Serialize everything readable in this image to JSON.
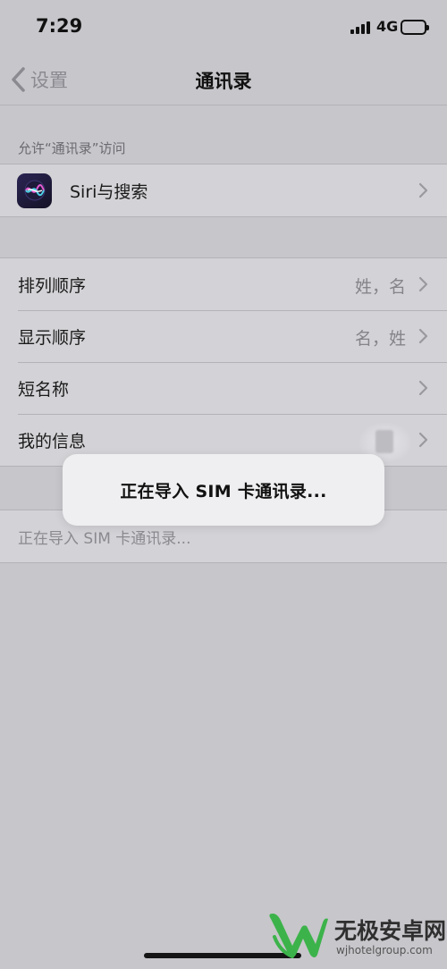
{
  "status_bar": {
    "time": "7:29",
    "network": "4G"
  },
  "nav": {
    "back_label": "设置",
    "title": "通讯录"
  },
  "section_header": "允许“通讯录”访问",
  "siri_row": {
    "label": "Siri与搜索"
  },
  "settings": {
    "sort_order": {
      "label": "排列顺序",
      "value": "姓，名"
    },
    "display_order": {
      "label": "显示顺序",
      "value": "名，姓"
    },
    "short_name": {
      "label": "短名称"
    },
    "my_info": {
      "label": "我的信息"
    }
  },
  "import_row": {
    "label": "正在导入 SIM 卡通讯录..."
  },
  "toast": {
    "message": "正在导入 SIM 卡通讯录..."
  },
  "watermark": {
    "title": "无极安卓网",
    "url": "wjhotelgroup.com"
  },
  "colors": {
    "background": "#c7c6cb",
    "row_background": "#d3d2d6",
    "toast_background": "#efeff1",
    "watermark_green": "#3cb34a"
  }
}
